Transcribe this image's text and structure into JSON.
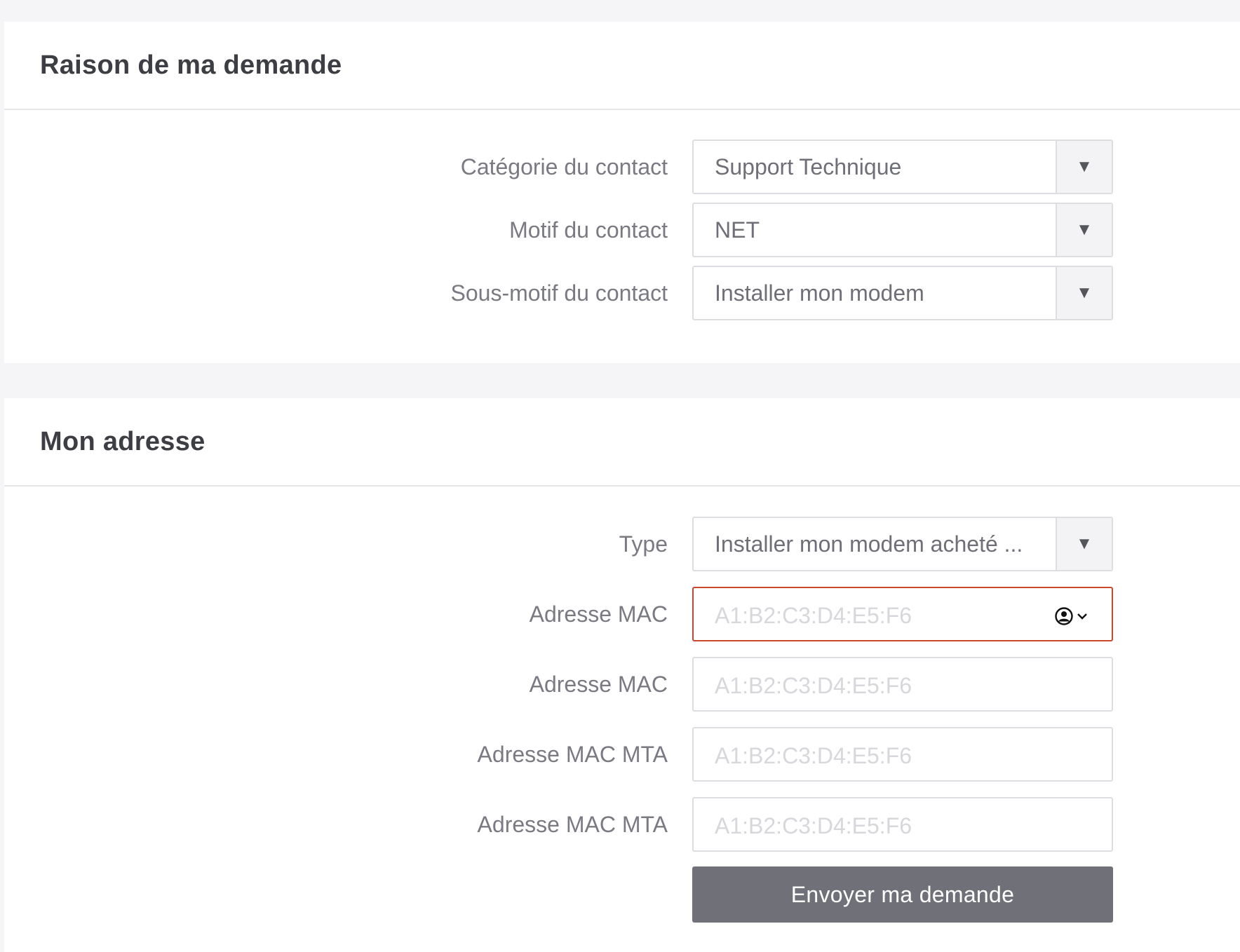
{
  "section_reason": {
    "title": "Raison de ma demande",
    "fields": [
      {
        "label": "Catégorie du contact",
        "value": "Support Technique"
      },
      {
        "label": "Motif du contact",
        "value": "NET"
      },
      {
        "label": "Sous-motif du contact",
        "value": "Installer mon modem"
      }
    ]
  },
  "section_address": {
    "title": "Mon adresse",
    "type": {
      "label": "Type",
      "value": "Installer mon modem acheté ..."
    },
    "inputs": [
      {
        "label": "Adresse MAC",
        "placeholder": "A1:B2:C3:D4:E5:F6",
        "value": ""
      },
      {
        "label": "Adresse MAC",
        "placeholder": "A1:B2:C3:D4:E5:F6",
        "value": ""
      },
      {
        "label": "Adresse MAC MTA",
        "placeholder": "A1:B2:C3:D4:E5:F6",
        "value": ""
      },
      {
        "label": "Adresse MAC MTA",
        "placeholder": "A1:B2:C3:D4:E5:F6",
        "value": ""
      }
    ],
    "submit_label": "Envoyer ma demande"
  },
  "icons": {
    "select_arrow": "triangle-down-icon",
    "autofill": "contact-autofill-icon"
  },
  "colors": {
    "error_border": "#c8472d",
    "button_bg": "#707078"
  }
}
